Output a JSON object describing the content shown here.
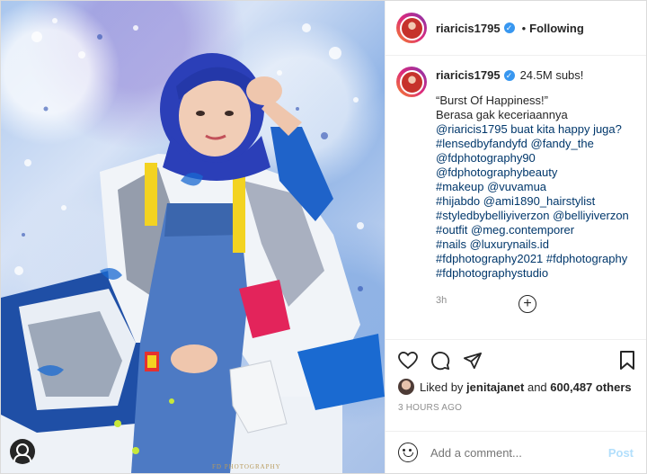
{
  "header": {
    "username": "riaricis1795",
    "separator": "•",
    "follow_status": "Following"
  },
  "caption": {
    "username": "riaricis1795",
    "subs": "24.5M subs!",
    "lines": [
      "“Burst Of Happiness!”",
      "Berasa gak keceriaannya",
      "@riaricis1795 buat kita happy juga?",
      "#lensedbyfandyfd @fandy_the",
      "@fdphotography90",
      "@fdphotographybeauty",
      "#makeup @vuvamua",
      "#hijabdo @ami1890_hairstylist",
      "#styledbybelliyiverzon @belliyiverzon",
      "#outfit @meg.contemporer",
      "#nails @luxurynails.id",
      "#fdphotography2021 #fdphotography",
      "#fdphotographystudio"
    ],
    "time": "3h"
  },
  "likes": {
    "prefix": "Liked by",
    "user": "jenitajanet",
    "middle": "and",
    "others": "600,487 others"
  },
  "posted_ago": "3 HOURS AGO",
  "comment_box": {
    "placeholder": "Add a comment...",
    "post_label": "Post"
  },
  "photo": {
    "watermark": "FD PHOTOGRAPHY"
  },
  "icons": {
    "like": "heart-icon",
    "comment": "comment-icon",
    "share": "paper-plane-icon",
    "save": "bookmark-icon",
    "load_more": "plus-circle-icon",
    "emoji": "emoji-icon",
    "verified": "verified-badge-icon",
    "photo_tags": "user-tag-icon"
  },
  "colors": {
    "link": "#00376b",
    "verified": "#3897f0",
    "post_button": "#b2dffc"
  }
}
